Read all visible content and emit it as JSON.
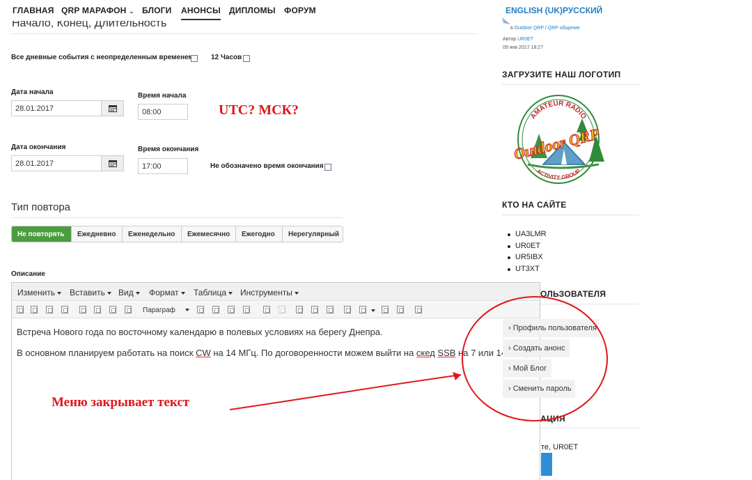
{
  "nav": {
    "items": [
      "Главная",
      "QRP марафон",
      "Блоги",
      "Анонсы",
      "Дипломы",
      "Форум"
    ],
    "active_index": 3,
    "languages": [
      "ENGLISH (UK)",
      "РУССКИЙ"
    ]
  },
  "form": {
    "section_title": "Начало, Конец, Длительность",
    "all_day_label": "Все дневные события с неопределенным временем",
    "hours12_label": "12 Часов",
    "start_date_label": "Дата начала",
    "start_date_value": "28.01.2017",
    "start_time_label": "Время начала",
    "start_time_value": "08:00",
    "end_date_label": "Дата окончания",
    "end_date_value": "28.01.2017",
    "end_time_label": "Время окончания",
    "end_time_value": "17:00",
    "no_end_time_label": "Не обозначено время окончания",
    "repeat_title": "Тип повтора",
    "repeat_tabs": [
      "Не повторять",
      "Ежедневно",
      "Еженедельно",
      "Ежемесячно",
      "Ежегодно",
      "Нерегулярный"
    ],
    "repeat_active_index": 0,
    "description_label": "Описание"
  },
  "editor": {
    "menus": [
      "Изменить",
      "Вставить",
      "Вид",
      "Формат",
      "Таблица",
      "Инструменты"
    ],
    "paragraph_label": "Параграф",
    "line1": "Встреча Нового года по восточному календарю в полевых условиях на берегу Днепра.",
    "line2_pre": "В основном планируем работать на поиск ",
    "line2_cw": "CW",
    "line2_mid": " на 14 МГц. По договоренности можем выйти на ",
    "line2_sked": "скед",
    "line2_sp": " ",
    "line2_ssb": "SSB",
    "line2_post": " на 7 или 14 МГц"
  },
  "annotations": {
    "utc_msk": "UTC? МСК?",
    "menu_covers": "Меню закрывает текст",
    "annotation_color": "#e0161b"
  },
  "sidebar": {
    "blog_cat1": "Outdoor QRP",
    "blog_sep": " / ",
    "blog_cat2": "QRP общение",
    "author_prefix": "Автор ",
    "author": "UR0ET",
    "date": "09 янв 2017 18:27",
    "logo_heading": "Загрузите наш логотип",
    "logo_top": "AMATEUR RADIO",
    "logo_main": "Outdoor QRP",
    "logo_bottom": "ACTIVITY GROUP",
    "online_heading": "Кто на сайте",
    "users": [
      "UA3LMR",
      "UR0ET",
      "UR5IBX",
      "UT3XT"
    ],
    "user_menu_heading_partial": "ользователя",
    "user_menu": [
      "Профиль пользователя",
      "Создать анонс",
      "Мой Блог",
      "Сменить пароль"
    ],
    "auth_heading_partial": "ация",
    "greeting_partial": "те, UR0ET"
  }
}
